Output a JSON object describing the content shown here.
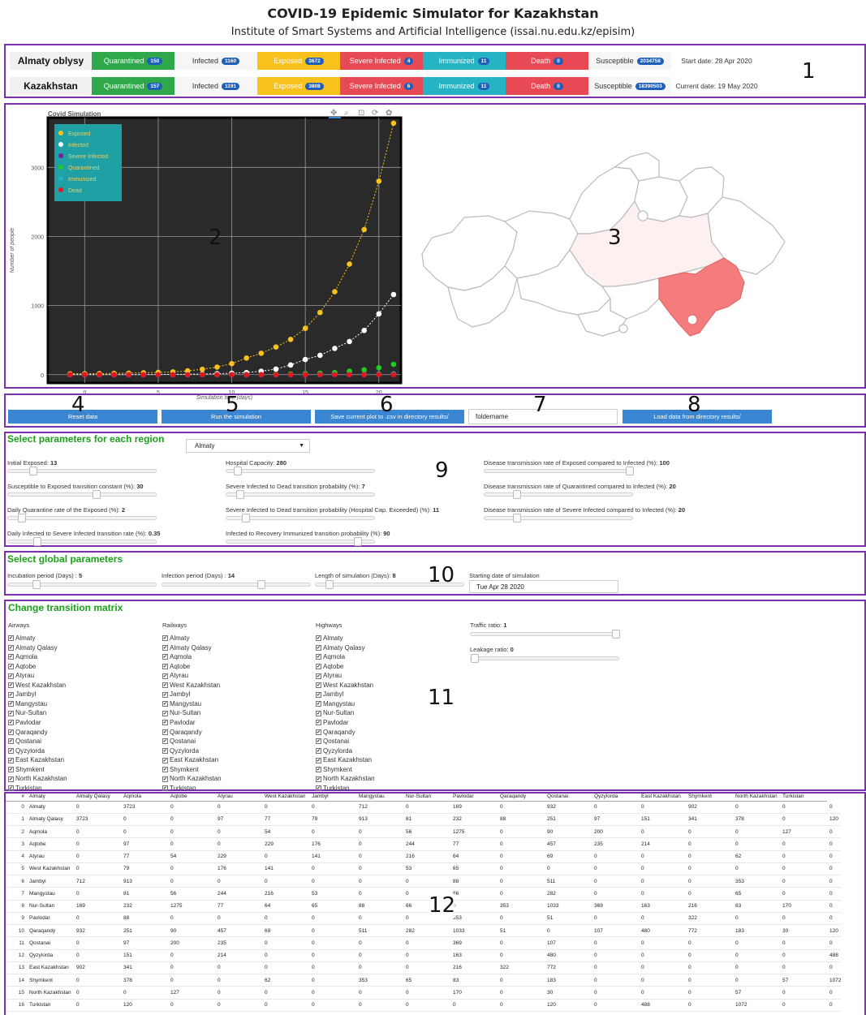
{
  "header": {
    "title": "COVID-19 Epidemic Simulator for Kazakhstan",
    "subtitle": "Institute of Smart Systems and Artificial Intelligence (issai.nu.edu.kz/episim)"
  },
  "region_labels": [
    "1",
    "2",
    "3",
    "4",
    "5",
    "6",
    "7",
    "8",
    "9",
    "10",
    "11",
    "12"
  ],
  "stats": {
    "rows": [
      {
        "name": "Almaty oblysy",
        "quarantined": "150",
        "infected": "1160",
        "exposed": "3672",
        "severe": "4",
        "immunized": "11",
        "death": "0",
        "susceptible": "2034758",
        "date": "Start date: 28 Apr 2020"
      },
      {
        "name": "Kazakhstan",
        "quarantined": "157",
        "infected": "1191",
        "exposed": "3808",
        "severe": "6",
        "immunized": "11",
        "death": "0",
        "susceptible": "18390503",
        "date": "Current date: 19 May 2020"
      }
    ],
    "labels": {
      "quarantined": "Quarantined",
      "infected": "Infected",
      "exposed": "Exposed",
      "severe": "Severe Infected",
      "immunized": "Immunized",
      "death": "Death",
      "susceptible": "Susceptible"
    },
    "colors": {
      "quarantined": "#2ea84a",
      "exposed": "#f8c11b",
      "severe": "#e84a55",
      "immunized": "#26b3c4",
      "death": "#e84a55"
    }
  },
  "chart_data": {
    "type": "line",
    "title": "Covid Simulation",
    "xlabel": "Simulation time (days)",
    "ylabel": "Number of people",
    "xlim": [
      -2.5,
      21.5
    ],
    "ylim": [
      -120,
      3720
    ],
    "xticks": [
      0,
      5,
      10,
      15,
      20
    ],
    "yticks": [
      0,
      1000,
      2000,
      3000
    ],
    "x": [
      -1,
      0,
      1,
      2,
      3,
      4,
      5,
      6,
      7,
      8,
      9,
      10,
      11,
      12,
      13,
      14,
      15,
      16,
      17,
      18,
      19,
      20,
      21
    ],
    "legend_position": "top-left",
    "series": [
      {
        "name": "Exposed",
        "color": "#f8c11b",
        "values": [
          13,
          14,
          16,
          19,
          22,
          27,
          33,
          40,
          55,
          78,
          110,
          160,
          240,
          310,
          400,
          510,
          670,
          900,
          1200,
          1600,
          2100,
          2800,
          3640
        ]
      },
      {
        "name": "Infected",
        "color": "#ffffff",
        "values": [
          0,
          0,
          0,
          0,
          0,
          1,
          2,
          4,
          6,
          9,
          14,
          20,
          30,
          50,
          80,
          140,
          220,
          280,
          380,
          480,
          640,
          880,
          1160
        ]
      },
      {
        "name": "Severe Infected",
        "color": "#7a1fa2",
        "values": [
          0,
          0,
          0,
          0,
          0,
          0,
          0,
          0,
          0,
          0,
          0,
          0,
          0,
          0,
          0,
          0,
          0,
          1,
          1,
          2,
          2,
          3,
          4
        ]
      },
      {
        "name": "Quarantined",
        "color": "#22cc22",
        "values": [
          0,
          0,
          0,
          0,
          0,
          0,
          0,
          0,
          0,
          0,
          0,
          1,
          2,
          3,
          6,
          10,
          15,
          22,
          30,
          50,
          70,
          100,
          150
        ]
      },
      {
        "name": "Immunized",
        "color": "#26b3c4",
        "values": [
          0,
          0,
          0,
          0,
          0,
          0,
          0,
          0,
          0,
          0,
          0,
          0,
          0,
          0,
          0,
          0,
          1,
          2,
          3,
          4,
          6,
          8,
          11
        ]
      },
      {
        "name": "Dead",
        "color": "#e8141e",
        "values": [
          0,
          0,
          0,
          0,
          0,
          0,
          0,
          0,
          0,
          0,
          0,
          0,
          0,
          0,
          0,
          0,
          0,
          0,
          0,
          0,
          0,
          0,
          0
        ]
      }
    ]
  },
  "toolbar_icons": [
    "pan-icon",
    "zoom-icon",
    "box-zoom-icon",
    "reset-icon",
    "bokeh-logo-icon"
  ],
  "buttons": {
    "reset": "Reset data",
    "run": "Run the simulation",
    "save": "Save current plot to .csv in directory results/",
    "folder_value": "foldername",
    "load": "Load data from directory results/"
  },
  "region_params": {
    "title": "Select parameters for each region",
    "selected_region": "Almaty",
    "sliders": [
      {
        "label": "Initial Exposed: ",
        "value": "13",
        "pos": 0.15
      },
      {
        "label": "Susceptible to Exposed transition constant (%): ",
        "value": "30",
        "pos": 0.6
      },
      {
        "label": "Daily Quarantine rate of the Exposed (%): ",
        "value": "2",
        "pos": 0.07
      },
      {
        "label": "Daily Infected to Severe Infected transition rate (%): ",
        "value": "0.35",
        "pos": 0.18
      },
      {
        "label": "Hospital Capacity: ",
        "value": "280",
        "pos": 0.05
      },
      {
        "label": "Severe Infected to Dead transition probability (%): ",
        "value": "7",
        "pos": 0.07
      },
      {
        "label": "Severe Infected to Dead transition probability (Hospital Cap. Exceeded) (%): ",
        "value": "11",
        "pos": 0.11
      },
      {
        "label": "Infected to Recovery Immunized transition probability (%): ",
        "value": "90",
        "pos": 0.9
      },
      {
        "label": "Disease transmission rate of Exposed compared to Infected (%): ",
        "value": "100",
        "pos": 1.0
      },
      {
        "label": "Disease transmission rate of Quarantined compared to Infected (%): ",
        "value": "20",
        "pos": 0.2
      },
      {
        "label": "Disease transmission rate of Severe Infected compared to Infected (%): ",
        "value": "20",
        "pos": 0.2
      }
    ]
  },
  "global_params": {
    "title": "Select global parameters",
    "sliders": [
      {
        "label": "Incubation period (Days) : ",
        "value": "5",
        "pos": 0.17
      },
      {
        "label": "Infection period (Days) : ",
        "value": "14",
        "pos": 0.67
      },
      {
        "label": "Length of simulation (Days): ",
        "value": "8",
        "pos": 0.07
      }
    ],
    "date_label": "Starting date of simulation",
    "date_value": "Tue Apr 28 2020"
  },
  "transition": {
    "title": "Change transition matrix",
    "airways": "Airways",
    "railways": "Railways",
    "highways": "Highways",
    "regions": [
      "Almaty",
      "Almaty Qalasy",
      "Aqmola",
      "Aqtobe",
      "Atyrau",
      "West Kazakhstan",
      "Jambyl",
      "Mangystau",
      "Nur-Sultan",
      "Pavlodar",
      "Qaraqandy",
      "Qostanai",
      "Qyzylorda",
      "East Kazakhstan",
      "Shymkent",
      "North Kazakhstan",
      "Turkistan"
    ],
    "check_mark": "✔",
    "traffic_label": "Traffic ratio: ",
    "traffic_value": "1",
    "traffic_pos": 1.0,
    "leakage_label": "Leakage ratio: ",
    "leakage_value": "0",
    "leakage_pos": 0.0
  },
  "matrix": {
    "headers": [
      "#",
      "Almaty",
      "Almaty Qalasy",
      "Aqmola",
      "Aqtobe",
      "Atyrau",
      "West Kazakhstan",
      "Jambyl",
      "Mangystau",
      "Nur-Sultan",
      "Pavlodar",
      "Qaraqandy",
      "Qostanai",
      "Qyzylorda",
      "East Kazakhstan",
      "Shymkent",
      "North Kazakhstan",
      "Turkistan"
    ],
    "rows": [
      [
        "0",
        "Almaty",
        "0",
        "3723",
        "0",
        "0",
        "0",
        "0",
        "712",
        "0",
        "169",
        "0",
        "932",
        "0",
        "0",
        "902",
        "0",
        "0",
        "0"
      ],
      [
        "1",
        "Almaty Qalasy",
        "3723",
        "0",
        "0",
        "97",
        "77",
        "79",
        "913",
        "81",
        "232",
        "88",
        "251",
        "97",
        "151",
        "341",
        "378",
        "0",
        "120"
      ],
      [
        "2",
        "Aqmola",
        "0",
        "0",
        "0",
        "0",
        "54",
        "0",
        "0",
        "56",
        "1275",
        "0",
        "90",
        "200",
        "0",
        "0",
        "0",
        "127",
        "0"
      ],
      [
        "3",
        "Aqtobe",
        "0",
        "97",
        "0",
        "0",
        "229",
        "176",
        "0",
        "244",
        "77",
        "0",
        "457",
        "235",
        "214",
        "0",
        "0",
        "0",
        "0"
      ],
      [
        "4",
        "Atyrau",
        "0",
        "77",
        "54",
        "229",
        "0",
        "141",
        "0",
        "216",
        "64",
        "0",
        "69",
        "0",
        "0",
        "0",
        "62",
        "0",
        "0"
      ],
      [
        "5",
        "West Kazakhstan",
        "0",
        "79",
        "0",
        "176",
        "141",
        "0",
        "0",
        "53",
        "65",
        "0",
        "0",
        "0",
        "0",
        "0",
        "0",
        "0",
        "0"
      ],
      [
        "6",
        "Jambyl",
        "712",
        "913",
        "0",
        "0",
        "0",
        "0",
        "0",
        "0",
        "88",
        "0",
        "511",
        "0",
        "0",
        "0",
        "353",
        "0",
        "0"
      ],
      [
        "7",
        "Mangystau",
        "0",
        "81",
        "56",
        "244",
        "216",
        "53",
        "0",
        "0",
        "66",
        "0",
        "282",
        "0",
        "0",
        "0",
        "65",
        "0",
        "0"
      ],
      [
        "8",
        "Nur-Sultan",
        "169",
        "232",
        "1275",
        "77",
        "64",
        "65",
        "88",
        "66",
        "0",
        "353",
        "1033",
        "369",
        "163",
        "216",
        "83",
        "170",
        "0"
      ],
      [
        "9",
        "Pavlodar",
        "0",
        "88",
        "0",
        "0",
        "0",
        "0",
        "0",
        "0",
        "353",
        "0",
        "51",
        "0",
        "0",
        "322",
        "0",
        "0",
        "0"
      ],
      [
        "10",
        "Qaraqandy",
        "932",
        "251",
        "90",
        "457",
        "69",
        "0",
        "511",
        "282",
        "1033",
        "51",
        "0",
        "107",
        "480",
        "772",
        "183",
        "30",
        "120"
      ],
      [
        "11",
        "Qostanai",
        "0",
        "97",
        "200",
        "235",
        "0",
        "0",
        "0",
        "0",
        "369",
        "0",
        "107",
        "0",
        "0",
        "0",
        "0",
        "0",
        "0"
      ],
      [
        "12",
        "Qyzylorda",
        "0",
        "151",
        "0",
        "214",
        "0",
        "0",
        "0",
        "0",
        "163",
        "0",
        "480",
        "0",
        "0",
        "0",
        "0",
        "0",
        "488"
      ],
      [
        "13",
        "East Kazakhstan",
        "902",
        "341",
        "0",
        "0",
        "0",
        "0",
        "0",
        "0",
        "216",
        "322",
        "772",
        "0",
        "0",
        "0",
        "0",
        "0",
        "0"
      ],
      [
        "14",
        "Shymkent",
        "0",
        "378",
        "0",
        "0",
        "62",
        "0",
        "353",
        "65",
        "83",
        "0",
        "183",
        "0",
        "0",
        "0",
        "0",
        "57",
        "1072"
      ],
      [
        "15",
        "North Kazakhstan",
        "0",
        "0",
        "127",
        "0",
        "0",
        "0",
        "0",
        "0",
        "170",
        "0",
        "30",
        "0",
        "0",
        "0",
        "57",
        "0",
        "0"
      ],
      [
        "16",
        "Turkistan",
        "0",
        "120",
        "0",
        "0",
        "0",
        "0",
        "0",
        "0",
        "0",
        "0",
        "120",
        "0",
        "488",
        "0",
        "1072",
        "0",
        "0"
      ]
    ]
  }
}
